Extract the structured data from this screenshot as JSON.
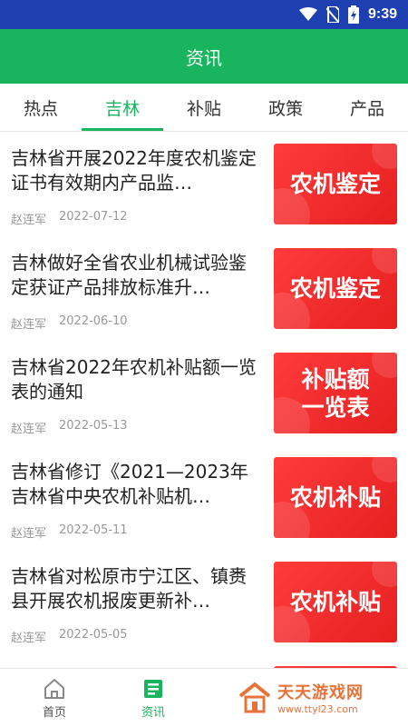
{
  "status": {
    "time": "9:39"
  },
  "header": {
    "title": "资讯"
  },
  "tabs": [
    {
      "label": "热点"
    },
    {
      "label": "吉林"
    },
    {
      "label": "补贴"
    },
    {
      "label": "政策"
    },
    {
      "label": "产品"
    }
  ],
  "active_tab": "吉林",
  "articles": [
    {
      "title": "吉林省开展2022年度农机鉴定证书有效期内产品监…",
      "author": "赵连军",
      "date": "2022-07-12",
      "thumb_text": "农机鉴定"
    },
    {
      "title": "吉林做好全省农业机械试验鉴定获证产品排放标准升…",
      "author": "赵连军",
      "date": "2022-06-10",
      "thumb_text": "农机鉴定"
    },
    {
      "title": "吉林省2022年农机补贴额一览表的通知",
      "author": "赵连军",
      "date": "2022-05-13",
      "thumb_text": "补贴额\n一览表"
    },
    {
      "title": "吉林省修订《2021—2023年吉林省中央农机补贴机…",
      "author": "赵连军",
      "date": "2022-05-11",
      "thumb_text": "农机补贴"
    },
    {
      "title": "吉林省对松原市宁江区、镇赉县开展农机报废更新补…",
      "author": "赵连军",
      "date": "2022-05-05",
      "thumb_text": "农机补贴"
    }
  ],
  "bottom_nav": [
    {
      "label": "首页",
      "icon": "home-icon"
    },
    {
      "label": "资讯",
      "icon": "news-icon"
    }
  ],
  "watermark": {
    "main": "天天游戏网",
    "sub": "www.ttyl23.com"
  },
  "colors": {
    "primary": "#18b55e",
    "statusbar": "#1e3fb0",
    "thumb": "#e61f1f"
  }
}
